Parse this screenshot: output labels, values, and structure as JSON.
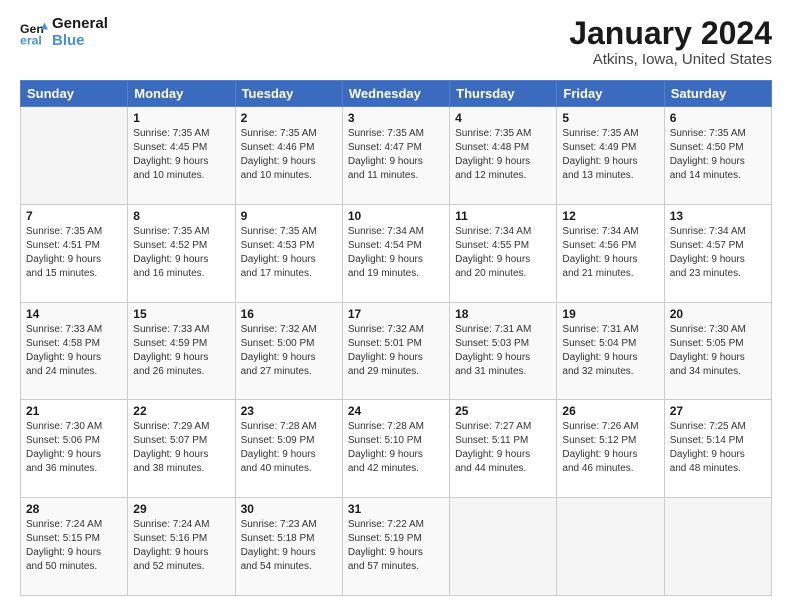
{
  "header": {
    "logo_line1": "General",
    "logo_line2": "Blue",
    "month": "January 2024",
    "location": "Atkins, Iowa, United States"
  },
  "weekdays": [
    "Sunday",
    "Monday",
    "Tuesday",
    "Wednesday",
    "Thursday",
    "Friday",
    "Saturday"
  ],
  "weeks": [
    [
      {
        "day": "",
        "info": ""
      },
      {
        "day": "1",
        "info": "Sunrise: 7:35 AM\nSunset: 4:45 PM\nDaylight: 9 hours\nand 10 minutes."
      },
      {
        "day": "2",
        "info": "Sunrise: 7:35 AM\nSunset: 4:46 PM\nDaylight: 9 hours\nand 10 minutes."
      },
      {
        "day": "3",
        "info": "Sunrise: 7:35 AM\nSunset: 4:47 PM\nDaylight: 9 hours\nand 11 minutes."
      },
      {
        "day": "4",
        "info": "Sunrise: 7:35 AM\nSunset: 4:48 PM\nDaylight: 9 hours\nand 12 minutes."
      },
      {
        "day": "5",
        "info": "Sunrise: 7:35 AM\nSunset: 4:49 PM\nDaylight: 9 hours\nand 13 minutes."
      },
      {
        "day": "6",
        "info": "Sunrise: 7:35 AM\nSunset: 4:50 PM\nDaylight: 9 hours\nand 14 minutes."
      }
    ],
    [
      {
        "day": "7",
        "info": "Sunrise: 7:35 AM\nSunset: 4:51 PM\nDaylight: 9 hours\nand 15 minutes."
      },
      {
        "day": "8",
        "info": "Sunrise: 7:35 AM\nSunset: 4:52 PM\nDaylight: 9 hours\nand 16 minutes."
      },
      {
        "day": "9",
        "info": "Sunrise: 7:35 AM\nSunset: 4:53 PM\nDaylight: 9 hours\nand 17 minutes."
      },
      {
        "day": "10",
        "info": "Sunrise: 7:34 AM\nSunset: 4:54 PM\nDaylight: 9 hours\nand 19 minutes."
      },
      {
        "day": "11",
        "info": "Sunrise: 7:34 AM\nSunset: 4:55 PM\nDaylight: 9 hours\nand 20 minutes."
      },
      {
        "day": "12",
        "info": "Sunrise: 7:34 AM\nSunset: 4:56 PM\nDaylight: 9 hours\nand 21 minutes."
      },
      {
        "day": "13",
        "info": "Sunrise: 7:34 AM\nSunset: 4:57 PM\nDaylight: 9 hours\nand 23 minutes."
      }
    ],
    [
      {
        "day": "14",
        "info": "Sunrise: 7:33 AM\nSunset: 4:58 PM\nDaylight: 9 hours\nand 24 minutes."
      },
      {
        "day": "15",
        "info": "Sunrise: 7:33 AM\nSunset: 4:59 PM\nDaylight: 9 hours\nand 26 minutes."
      },
      {
        "day": "16",
        "info": "Sunrise: 7:32 AM\nSunset: 5:00 PM\nDaylight: 9 hours\nand 27 minutes."
      },
      {
        "day": "17",
        "info": "Sunrise: 7:32 AM\nSunset: 5:01 PM\nDaylight: 9 hours\nand 29 minutes."
      },
      {
        "day": "18",
        "info": "Sunrise: 7:31 AM\nSunset: 5:03 PM\nDaylight: 9 hours\nand 31 minutes."
      },
      {
        "day": "19",
        "info": "Sunrise: 7:31 AM\nSunset: 5:04 PM\nDaylight: 9 hours\nand 32 minutes."
      },
      {
        "day": "20",
        "info": "Sunrise: 7:30 AM\nSunset: 5:05 PM\nDaylight: 9 hours\nand 34 minutes."
      }
    ],
    [
      {
        "day": "21",
        "info": "Sunrise: 7:30 AM\nSunset: 5:06 PM\nDaylight: 9 hours\nand 36 minutes."
      },
      {
        "day": "22",
        "info": "Sunrise: 7:29 AM\nSunset: 5:07 PM\nDaylight: 9 hours\nand 38 minutes."
      },
      {
        "day": "23",
        "info": "Sunrise: 7:28 AM\nSunset: 5:09 PM\nDaylight: 9 hours\nand 40 minutes."
      },
      {
        "day": "24",
        "info": "Sunrise: 7:28 AM\nSunset: 5:10 PM\nDaylight: 9 hours\nand 42 minutes."
      },
      {
        "day": "25",
        "info": "Sunrise: 7:27 AM\nSunset: 5:11 PM\nDaylight: 9 hours\nand 44 minutes."
      },
      {
        "day": "26",
        "info": "Sunrise: 7:26 AM\nSunset: 5:12 PM\nDaylight: 9 hours\nand 46 minutes."
      },
      {
        "day": "27",
        "info": "Sunrise: 7:25 AM\nSunset: 5:14 PM\nDaylight: 9 hours\nand 48 minutes."
      }
    ],
    [
      {
        "day": "28",
        "info": "Sunrise: 7:24 AM\nSunset: 5:15 PM\nDaylight: 9 hours\nand 50 minutes."
      },
      {
        "day": "29",
        "info": "Sunrise: 7:24 AM\nSunset: 5:16 PM\nDaylight: 9 hours\nand 52 minutes."
      },
      {
        "day": "30",
        "info": "Sunrise: 7:23 AM\nSunset: 5:18 PM\nDaylight: 9 hours\nand 54 minutes."
      },
      {
        "day": "31",
        "info": "Sunrise: 7:22 AM\nSunset: 5:19 PM\nDaylight: 9 hours\nand 57 minutes."
      },
      {
        "day": "",
        "info": ""
      },
      {
        "day": "",
        "info": ""
      },
      {
        "day": "",
        "info": ""
      }
    ]
  ]
}
